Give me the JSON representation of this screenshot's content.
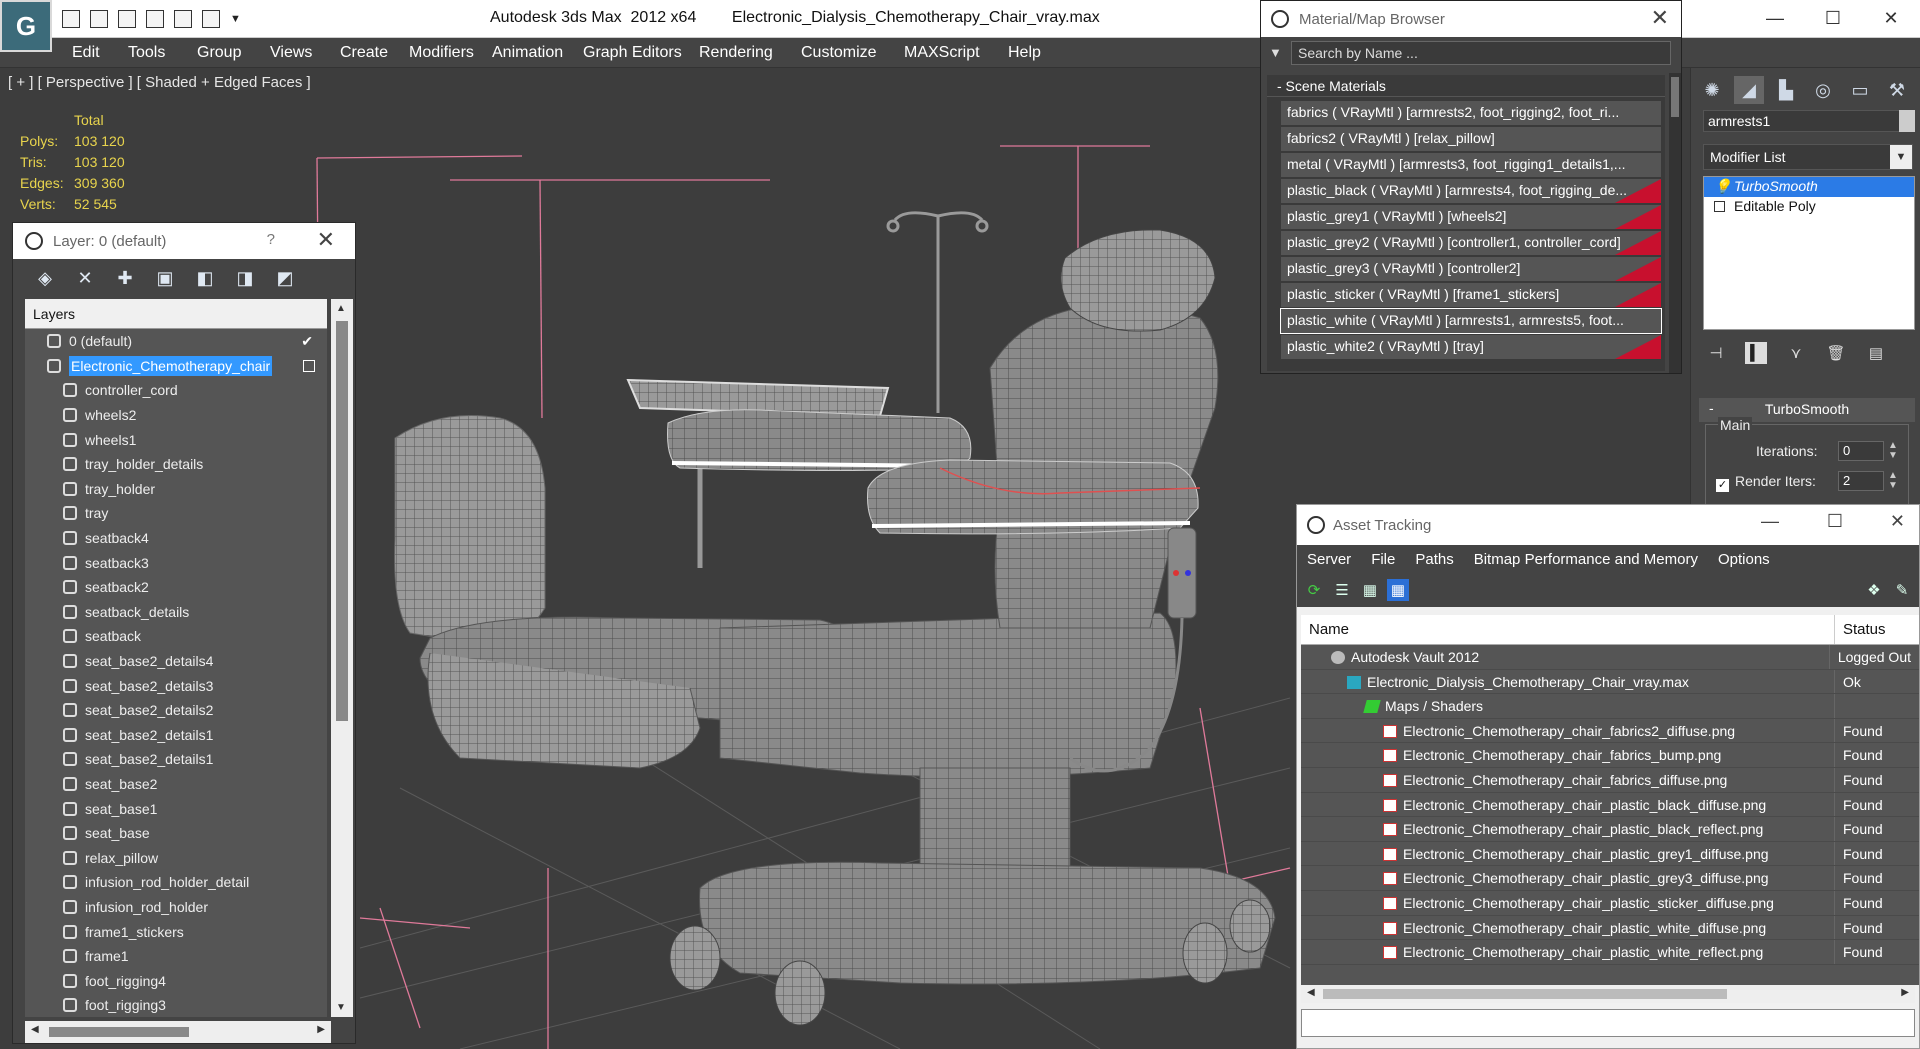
{
  "window": {
    "app": "Autodesk 3ds Max  2012 x64",
    "file": "Electronic_Dialysis_Chemotherapy_Chair_vray.max"
  },
  "menu": [
    "Edit",
    "Tools",
    "Group",
    "Views",
    "Create",
    "Modifiers",
    "Animation",
    "Graph Editors",
    "Rendering",
    "Customize",
    "MAXScript",
    "Help"
  ],
  "viewport": {
    "label": "[ + ] [ Perspective ] [ Shaded + Edged Faces ]",
    "stats": {
      "header": "Total",
      "rows": [
        {
          "k": "Polys:",
          "v": "103 120"
        },
        {
          "k": "Tris:",
          "v": "103 120"
        },
        {
          "k": "Edges:",
          "v": "309 360"
        },
        {
          "k": "Verts:",
          "v": "52 545"
        }
      ]
    }
  },
  "layer_dialog": {
    "title": "Layer: 0 (default)",
    "help": "?",
    "header": "Layers",
    "rows": [
      {
        "name": "0 (default)",
        "type": "layer",
        "level": 1,
        "checked": true
      },
      {
        "name": "Electronic_Chemotherapy_chair",
        "type": "layer",
        "level": 1,
        "selected": true
      },
      {
        "name": "controller_cord",
        "type": "object",
        "level": 2
      },
      {
        "name": "wheels2",
        "type": "object",
        "level": 2
      },
      {
        "name": "wheels1",
        "type": "object",
        "level": 2
      },
      {
        "name": "tray_holder_details",
        "type": "object",
        "level": 2
      },
      {
        "name": "tray_holder",
        "type": "object",
        "level": 2
      },
      {
        "name": "tray",
        "type": "object",
        "level": 2
      },
      {
        "name": "seatback4",
        "type": "object",
        "level": 2
      },
      {
        "name": "seatback3",
        "type": "object",
        "level": 2
      },
      {
        "name": "seatback2",
        "type": "object",
        "level": 2
      },
      {
        "name": "seatback_details",
        "type": "object",
        "level": 2
      },
      {
        "name": "seatback",
        "type": "object",
        "level": 2
      },
      {
        "name": "seat_base2_details4",
        "type": "object",
        "level": 2
      },
      {
        "name": "seat_base2_details3",
        "type": "object",
        "level": 2
      },
      {
        "name": "seat_base2_details2",
        "type": "object",
        "level": 2
      },
      {
        "name": "seat_base2_details1",
        "type": "object",
        "level": 2
      },
      {
        "name": "seat_base2_details1",
        "type": "object",
        "level": 2
      },
      {
        "name": "seat_base2",
        "type": "object",
        "level": 2
      },
      {
        "name": "seat_base1",
        "type": "object",
        "level": 2
      },
      {
        "name": "seat_base",
        "type": "object",
        "level": 2
      },
      {
        "name": "relax_pillow",
        "type": "object",
        "level": 2
      },
      {
        "name": "infusion_rod_holder_detail",
        "type": "object",
        "level": 2
      },
      {
        "name": "infusion_rod_holder",
        "type": "object",
        "level": 2
      },
      {
        "name": "frame1_stickers",
        "type": "object",
        "level": 2
      },
      {
        "name": "frame1",
        "type": "object",
        "level": 2
      },
      {
        "name": "foot_rigging4",
        "type": "object",
        "level": 2
      },
      {
        "name": "foot_rigging3",
        "type": "object",
        "level": 2
      }
    ]
  },
  "material_browser": {
    "title": "Material/Map Browser",
    "search_placeholder": "Search by Name ...",
    "section": "- Scene Materials",
    "items": [
      {
        "text": "fabrics  ( VRayMtl ) [armrests2, foot_rigging2, foot_ri...",
        "swatch": false
      },
      {
        "text": "fabrics2  ( VRayMtl ) [relax_pillow]",
        "swatch": false
      },
      {
        "text": "metal  ( VRayMtl ) [armrests3, foot_rigging1_details1,...",
        "swatch": false
      },
      {
        "text": "plastic_black  ( VRayMtl ) [armrests4, foot_rigging_de...",
        "swatch": true
      },
      {
        "text": "plastic_grey1  ( VRayMtl ) [wheels2]",
        "swatch": true
      },
      {
        "text": "plastic_grey2  ( VRayMtl ) [controller1, controller_cord]",
        "swatch": true
      },
      {
        "text": "plastic_grey3  ( VRayMtl ) [controller2]",
        "swatch": true
      },
      {
        "text": "plastic_sticker  ( VRayMtl ) [frame1_stickers]",
        "swatch": true
      },
      {
        "text": "plastic_white  ( VRayMtl ) [armrests1, armrests5, foot...",
        "swatch": false,
        "selected": true
      },
      {
        "text": "plastic_white2  ( VRayMtl ) [tray]",
        "swatch": true
      }
    ],
    "swatch_color": "#c8102e"
  },
  "command_panel": {
    "object_name": "armrests1",
    "modifier_list": "Modifier List",
    "stack": [
      {
        "name": "TurboSmooth",
        "selected": true
      },
      {
        "name": "Editable Poly",
        "selected": false
      }
    ],
    "rollout": "TurboSmooth",
    "group": "Main",
    "iterations_label": "Iterations:",
    "iterations": "0",
    "render_iters_label": "Render Iters:",
    "render_iters": "2"
  },
  "asset_tracking": {
    "title": "Asset Tracking",
    "menu": [
      "Server",
      "File",
      "Paths",
      "Bitmap Performance and Memory",
      "Options"
    ],
    "col_name": "Name",
    "col_status": "Status",
    "rows": [
      {
        "name": "Autodesk Vault 2012",
        "status": "Logged Out",
        "icon": "vault",
        "level": 0
      },
      {
        "name": "Electronic_Dialysis_Chemotherapy_Chair_vray.max",
        "status": "Ok",
        "icon": "max",
        "level": 1
      },
      {
        "name": "Maps / Shaders",
        "status": "",
        "icon": "maps",
        "level": 2
      },
      {
        "name": "Electronic_Chemotherapy_chair_fabrics2_diffuse.png",
        "status": "Found",
        "icon": "png",
        "level": 3
      },
      {
        "name": "Electronic_Chemotherapy_chair_fabrics_bump.png",
        "status": "Found",
        "icon": "png",
        "level": 3
      },
      {
        "name": "Electronic_Chemotherapy_chair_fabrics_diffuse.png",
        "status": "Found",
        "icon": "png",
        "level": 3
      },
      {
        "name": "Electronic_Chemotherapy_chair_plastic_black_diffuse.png",
        "status": "Found",
        "icon": "png",
        "level": 3
      },
      {
        "name": "Electronic_Chemotherapy_chair_plastic_black_reflect.png",
        "status": "Found",
        "icon": "png",
        "level": 3
      },
      {
        "name": "Electronic_Chemotherapy_chair_plastic_grey1_diffuse.png",
        "status": "Found",
        "icon": "png",
        "level": 3
      },
      {
        "name": "Electronic_Chemotherapy_chair_plastic_grey3_diffuse.png",
        "status": "Found",
        "icon": "png",
        "level": 3
      },
      {
        "name": "Electronic_Chemotherapy_chair_plastic_sticker_diffuse.png",
        "status": "Found",
        "icon": "png",
        "level": 3
      },
      {
        "name": "Electronic_Chemotherapy_chair_plastic_white_diffuse.png",
        "status": "Found",
        "icon": "png",
        "level": 3
      },
      {
        "name": "Electronic_Chemotherapy_chair_plastic_white_reflect.png",
        "status": "Found",
        "icon": "png",
        "level": 3
      }
    ]
  },
  "colors": {
    "selection": "#3399ff",
    "stats_text": "#e8d44d",
    "grid_pink": "#e07a9a"
  }
}
